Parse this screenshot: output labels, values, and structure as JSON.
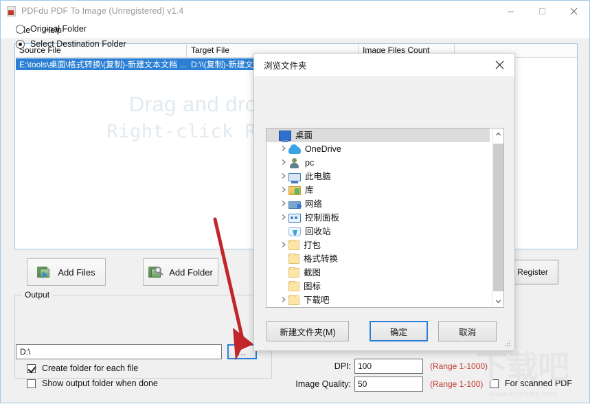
{
  "window": {
    "title": "PDFdu PDF To Image (Unregistered) v1.4",
    "icon": "pdf-app-icon",
    "buttons": {
      "minimize": "minimize-icon",
      "maximize": "maximize-icon",
      "close": "close-icon"
    }
  },
  "menu": {
    "items": [
      {
        "label": "File"
      },
      {
        "label": "Help"
      }
    ]
  },
  "file_list": {
    "columns": [
      {
        "label": "Source File"
      },
      {
        "label": "Target File"
      },
      {
        "label": "Image Files Count"
      },
      {
        "label": ""
      }
    ],
    "rows": [
      {
        "source": "E:\\tools\\桌面\\格式转换\\(复制)-新建文本文档 ...",
        "target": "D:\\\\(复制)-新建文..."
      }
    ],
    "drop_hint_line1": "Drag and drop your PDF files here",
    "drop_hint_line2": "Right-click Remove Selected Files"
  },
  "actions": {
    "add_files": "Add Files",
    "add_folder": "Add Folder",
    "register": "Register"
  },
  "output": {
    "legend": "Output",
    "original_folder": "Original Folder",
    "select_destination": "Select Destination Folder",
    "destination_path": "D:\\",
    "browse_button": "...",
    "create_folder_each_file": "Create folder for each file",
    "show_output_folder": "Show output folder when done"
  },
  "settings": {
    "dpi_label": "DPI:",
    "dpi_value": "100",
    "dpi_range": "(Range 1-1000)",
    "quality_label": "Image Quality:",
    "quality_value": "50",
    "quality_range": "(Range 1-100)",
    "scanned_pdf": "For scanned PDF"
  },
  "watermark": {
    "cn": "下载吧",
    "url": "www.xiazaiba.com"
  },
  "dialog": {
    "title": "浏览文件夹",
    "close": "close-icon",
    "tree": [
      {
        "label": "桌面",
        "icon": "desktop-icon",
        "expandable": false,
        "selected": true,
        "indent": 0
      },
      {
        "label": "OneDrive",
        "icon": "cloud-icon",
        "expandable": true,
        "selected": false,
        "indent": 1
      },
      {
        "label": "pc",
        "icon": "user-icon",
        "expandable": true,
        "selected": false,
        "indent": 1
      },
      {
        "label": "此电脑",
        "icon": "this-pc-icon",
        "expandable": true,
        "selected": false,
        "indent": 1
      },
      {
        "label": "库",
        "icon": "library-icon",
        "expandable": true,
        "selected": false,
        "indent": 1
      },
      {
        "label": "网络",
        "icon": "network-icon",
        "expandable": true,
        "selected": false,
        "indent": 1
      },
      {
        "label": "控制面板",
        "icon": "control-panel-icon",
        "expandable": true,
        "selected": false,
        "indent": 1
      },
      {
        "label": "回收站",
        "icon": "recycle-bin-icon",
        "expandable": false,
        "selected": false,
        "indent": 1
      },
      {
        "label": "打包",
        "icon": "folder-icon",
        "expandable": true,
        "selected": false,
        "indent": 1
      },
      {
        "label": "格式转换",
        "icon": "folder-icon",
        "expandable": false,
        "selected": false,
        "indent": 1
      },
      {
        "label": "截图",
        "icon": "folder-icon",
        "expandable": false,
        "selected": false,
        "indent": 1
      },
      {
        "label": "图标",
        "icon": "folder-icon",
        "expandable": false,
        "selected": false,
        "indent": 1
      },
      {
        "label": "下载吧",
        "icon": "folder-icon",
        "expandable": true,
        "selected": false,
        "indent": 1
      }
    ],
    "buttons": {
      "new_folder": "新建文件夹(M)",
      "ok": "确定",
      "cancel": "取消"
    }
  },
  "colors": {
    "accent": "#2a7fd4",
    "selection": "#2a7fd4",
    "warning_red": "#c0392b",
    "arrow_red": "#c0262a",
    "window_bg": "#f0f0f0"
  }
}
